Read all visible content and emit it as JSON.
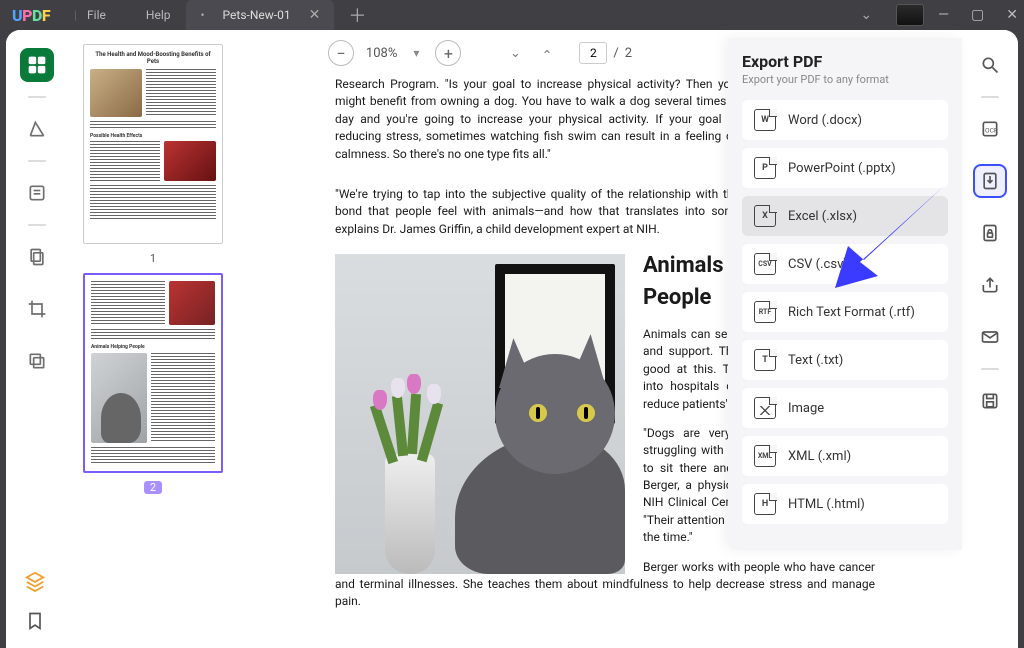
{
  "titlebar": {
    "logo": "UPDF",
    "menus": {
      "file": "File",
      "help": "Help"
    },
    "tab_name": "Pets-New-01"
  },
  "toolbar": {
    "zoom": "108%",
    "current_page": "2",
    "total_pages": "2"
  },
  "thumbnails": {
    "page1_num": "1",
    "page2_num": "2",
    "p1_title": "The Health and Mood-Boosting Benefits of Pets",
    "p1_h2": "Possible Health Effects",
    "p2_h": "Animals Helping People"
  },
  "doc": {
    "para1": "Research Program. \"Is your goal to increase physical activity? Then you might benefit from owning a dog. You have to walk a dog several times a day and you're going to increase your physical activity.  If your goal is reducing stress, sometimes watching fish swim can result in a feeling of calmness. So there's no one type fits all.\"",
    "para2": "\"We're trying to tap into the subjective quality of the relationship with the animal—that part of the bond that people feel with animals—and how that translates into some of the health benefits,\" explains Dr. James Griffin, a child development expert at NIH.",
    "heading": "Animals Helping People",
    "para3": "Animals can serve as a source of comfort and support. Therapy dogs are especially good at this. They're sometimes brought into hospitals or nursing homes to help reduce patients' stress and anxiety.",
    "para4": "\"Dogs are very present. If someone is struggling with something, they know how to sit there and be loving,\" says Dr. Ann Berger, a physician and researcher at the NIH Clinical Center in Bethesda, Maryland. \"Their attention is focused on the person all the time.\"",
    "para5": "Berger works with people who have cancer and terminal illnesses. She teaches them about mindfulness to help decrease stress and manage pain."
  },
  "export": {
    "title": "Export PDF",
    "sub": "Export your PDF to any format",
    "options": [
      {
        "label": "Word (.docx)",
        "badge": "W"
      },
      {
        "label": "PowerPoint (.pptx)",
        "badge": "P"
      },
      {
        "label": "Excel (.xlsx)",
        "badge": "X"
      },
      {
        "label": "CSV (.csv)",
        "badge": "CSV"
      },
      {
        "label": "Rich Text Format (.rtf)",
        "badge": "RTF"
      },
      {
        "label": "Text (.txt)",
        "badge": "T"
      },
      {
        "label": "Image",
        "badge": ""
      },
      {
        "label": "XML (.xml)",
        "badge": "XML"
      },
      {
        "label": "HTML (.html)",
        "badge": "H"
      }
    ]
  }
}
